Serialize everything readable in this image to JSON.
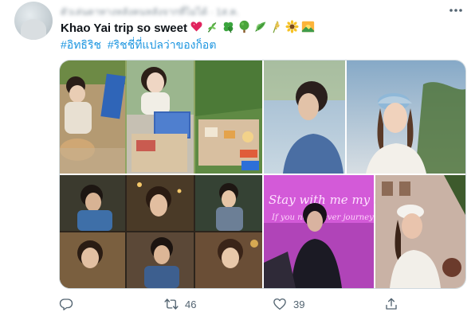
{
  "header": {
    "name_blurred": "ตัวเล่นตาทางหลังคนหลังจากที่ไม่ได้",
    "time_blurred": "· 1ส.ค."
  },
  "tweet": {
    "text": "Khao Yai  trip so sweet",
    "emojis": [
      "heart-emoji",
      "herb-emoji",
      "clover-emoji",
      "tree-emoji",
      "leaves-emoji",
      "rice-emoji",
      "sunflower-emoji",
      "sunrise-emoji"
    ],
    "hashtags": [
      "#อิทธิริช",
      "#ริชชี่ที่แปลว่าของก็อต"
    ]
  },
  "media": {
    "photo_text": [
      "Stay with me my love",
      "If you never ever journey"
    ]
  },
  "actions": {
    "retweets": "46",
    "likes": "39"
  },
  "colors": {
    "hashtag": "#1b95e0",
    "action": "#536471",
    "neon": "#e85adf"
  }
}
